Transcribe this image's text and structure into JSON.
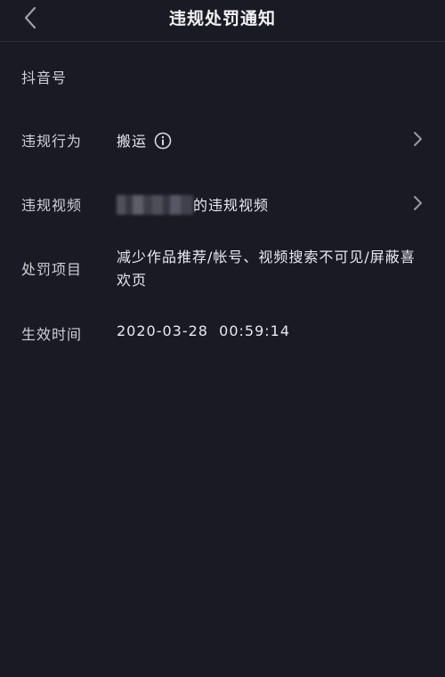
{
  "header": {
    "title": "违规处罚通知",
    "back_icon": "chevron-left-icon"
  },
  "rows": {
    "douyin_id": {
      "label": "抖音号",
      "value": ""
    },
    "violation_behavior": {
      "label": "违规行为",
      "value": "搬运",
      "info_icon": "info-icon",
      "chevron_icon": "chevron-right-icon"
    },
    "violation_video": {
      "label": "违规视频",
      "value_suffix": "的违规视频",
      "chevron_icon": "chevron-right-icon"
    },
    "penalty_items": {
      "label": "处罚项目",
      "value": "减少作品推荐/帐号、视频搜索不可见/屏蔽喜欢页"
    },
    "effective_time": {
      "label": "生效时间",
      "value": "2020-03-28  00:59:14"
    }
  },
  "colors": {
    "background": "#1a1a24",
    "text_primary": "#e8e8ee",
    "text_label": "#cfcfd6"
  }
}
